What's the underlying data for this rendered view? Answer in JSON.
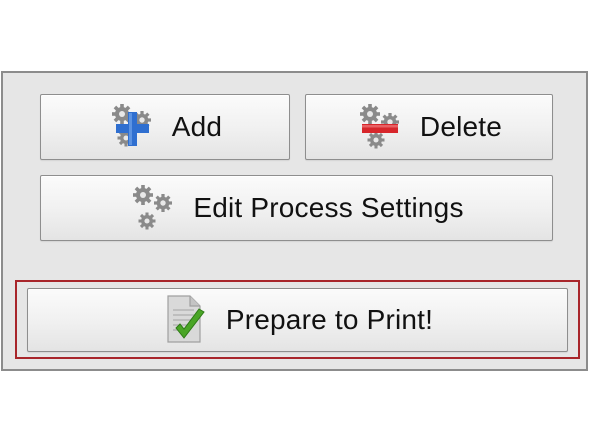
{
  "buttons": {
    "add_label": "Add",
    "delete_label": "Delete",
    "edit_label": "Edit Process Settings",
    "print_label": "Prepare to Print!"
  },
  "icons": {
    "add": "gears-plus-icon",
    "delete": "gears-minus-icon",
    "edit": "gears-icon",
    "print": "document-checkmark-icon"
  },
  "colors": {
    "plus": "#2f6fd0",
    "minus": "#d7262b",
    "check": "#4aa526",
    "highlight_border": "#a8262b"
  }
}
